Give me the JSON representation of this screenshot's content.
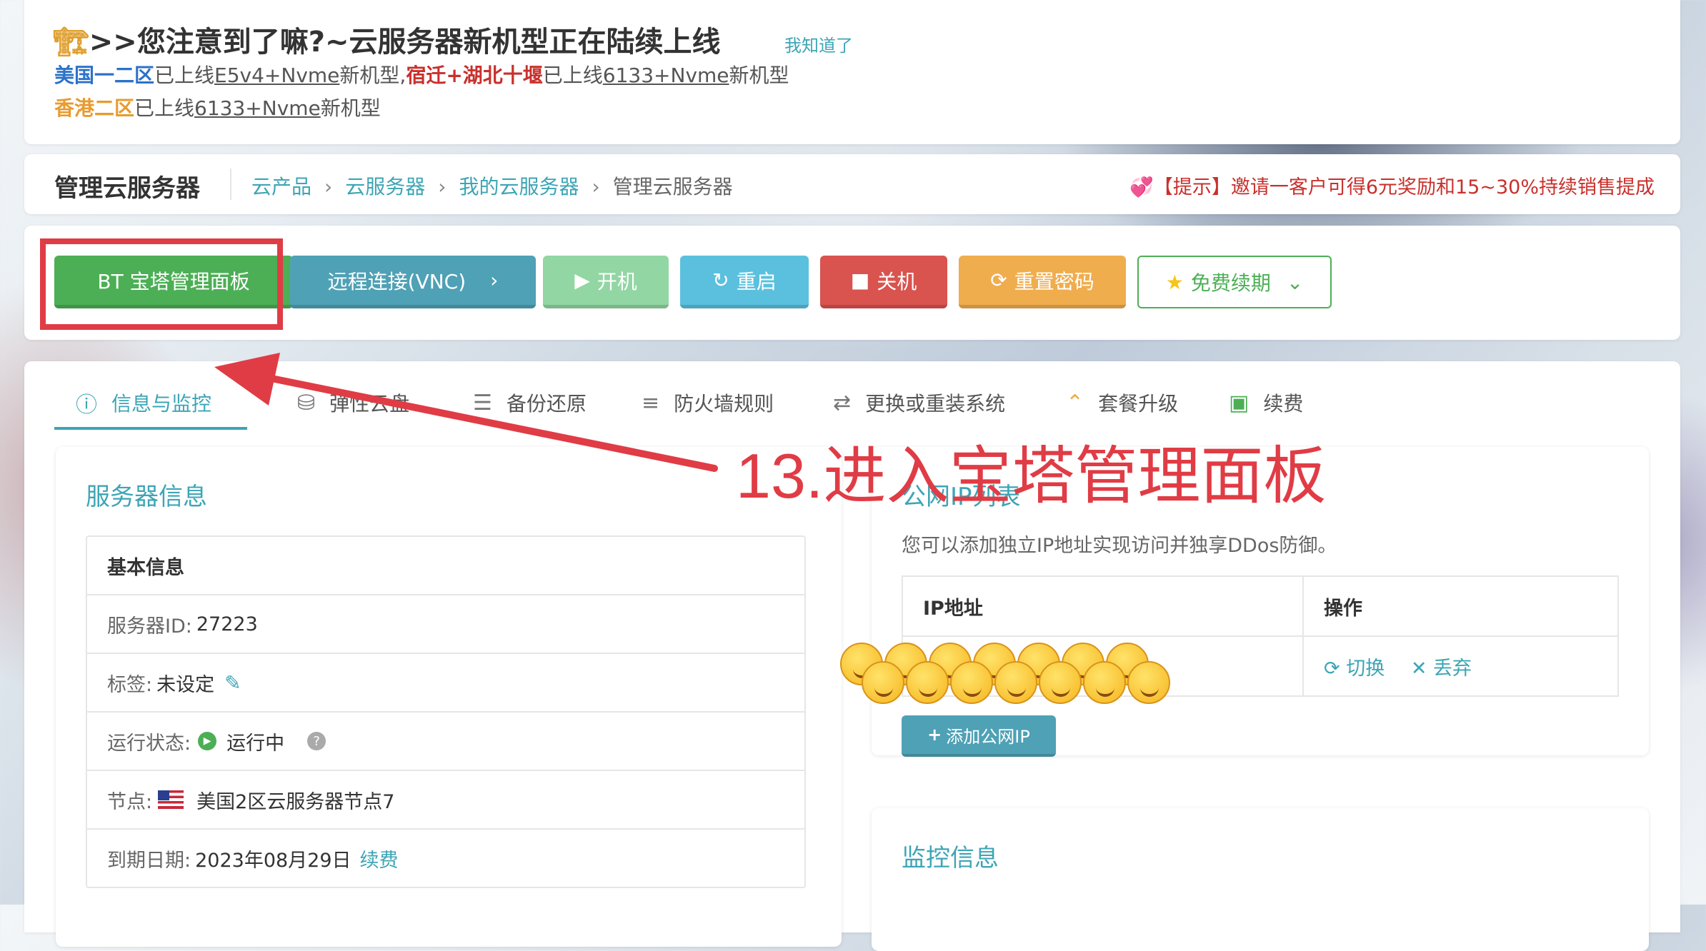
{
  "notice": {
    "icon": "construction-crane-icon",
    "title": ">>您注意到了嘛?~云服务器新机型正在陆续上线",
    "dismiss": "我知道了",
    "line1": {
      "region_a": "美国一二区",
      "text_a": "已上线",
      "model_a": "E5v4+Nvme",
      "text_b": "新机型,",
      "region_b": "宿迁+湖北十堰",
      "text_c": "已上线",
      "model_b": "6133+Nvme",
      "text_d": "新机型"
    },
    "line2": {
      "region": "香港二区",
      "text_a": "已上线",
      "model": "6133+Nvme",
      "text_b": "新机型"
    }
  },
  "header": {
    "title": "管理云服务器",
    "breadcrumbs": [
      "云产品",
      "云服务器",
      "我的云服务器",
      "管理云服务器"
    ],
    "tip": "【提示】邀请一客户可得6元奖励和15~30%持续销售提成"
  },
  "toolbar": {
    "bt_panel": "BT 宝塔管理面板",
    "vnc": "远程连接(VNC)",
    "start": "开机",
    "restart": "重启",
    "shutdown": "关机",
    "reset_password": "重置密码",
    "free_renew": "免费续期"
  },
  "tabs": [
    "信息与监控",
    "弹性云盘",
    "备份还原",
    "防火墙规则",
    "更换或重装系统",
    "套餐升级",
    "续费"
  ],
  "server_info": {
    "title": "服务器信息",
    "section": "基本信息",
    "id_label": "服务器ID:",
    "id_value": "27223",
    "tag_label": "标签:",
    "tag_value": "未设定",
    "status_label": "运行状态:",
    "status_value": "运行中",
    "node_label": "节点:",
    "node_value": "美国2区云服务器节点7",
    "expire_label": "到期日期:",
    "expire_value": "2023年08月29日",
    "renew_link": "续费"
  },
  "ip_list": {
    "title": "公网IP列表",
    "description": "您可以添加独立IP地址实现访问并独享DDos防御。",
    "col_ip": "IP地址",
    "col_action": "操作",
    "switch": "切换",
    "discard": "丢弃",
    "add_button": "添加公网IP"
  },
  "monitor": {
    "title": "监控信息"
  },
  "annotation": {
    "text": "13.进入宝塔管理面板",
    "color": "#e03c45"
  },
  "colors": {
    "accent": "#3da5b5",
    "green": "#4caf55",
    "red": "#d9534f",
    "orange": "#f0ad4e"
  }
}
